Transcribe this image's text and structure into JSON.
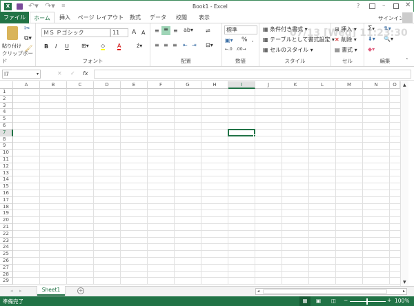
{
  "titlebar": {
    "title": "Book1 - Excel",
    "help": "?",
    "signin": "サインイン"
  },
  "tabs": [
    {
      "label": "ファイル"
    },
    {
      "label": "ホーム"
    },
    {
      "label": "挿入"
    },
    {
      "label": "ページ レイアウト"
    },
    {
      "label": "数式"
    },
    {
      "label": "データ"
    },
    {
      "label": "校閲"
    },
    {
      "label": "表示"
    }
  ],
  "ribbon": {
    "clipboard": {
      "label": "クリップボード",
      "paste": "貼り付け"
    },
    "font": {
      "label": "フォント",
      "name": "ＭＳ Ｐゴシック",
      "size": "11",
      "bold": "B",
      "italic": "I",
      "underline": "U",
      "grow": "A",
      "shrink": "A",
      "color": "A"
    },
    "alignment": {
      "label": "配置"
    },
    "number": {
      "label": "数値",
      "format": "標準",
      "percent": "%",
      "comma": ","
    },
    "styles": {
      "label": "スタイル",
      "conditional": "条件付き書式",
      "table": "テーブルとして書式設定",
      "cell": "セルのスタイル"
    },
    "cells": {
      "label": "セル",
      "insert": "挿入",
      "delete": "削除",
      "format": "書式"
    },
    "editing": {
      "label": "編集",
      "sum": "Σ"
    }
  },
  "watermark": "07/13 [Wed] 11:23:30",
  "formula_bar": {
    "name_box": "I7",
    "fx": "fx",
    "value": ""
  },
  "columns": [
    "A",
    "B",
    "C",
    "D",
    "E",
    "F",
    "G",
    "H",
    "I",
    "J",
    "K",
    "L",
    "M",
    "N",
    "O"
  ],
  "rows": [
    "1",
    "2",
    "3",
    "4",
    "5",
    "6",
    "7",
    "8",
    "9",
    "10",
    "11",
    "12",
    "13",
    "14",
    "15",
    "16",
    "17",
    "18",
    "19",
    "20",
    "21",
    "22",
    "23",
    "24",
    "25",
    "26",
    "27",
    "28",
    "29"
  ],
  "selected_cell": "I7",
  "sheets": [
    {
      "label": "Sheet1"
    }
  ],
  "status": {
    "text": "準備完了",
    "zoom": "100%"
  },
  "colors": {
    "accent": "#217346",
    "selection": "#217346"
  }
}
